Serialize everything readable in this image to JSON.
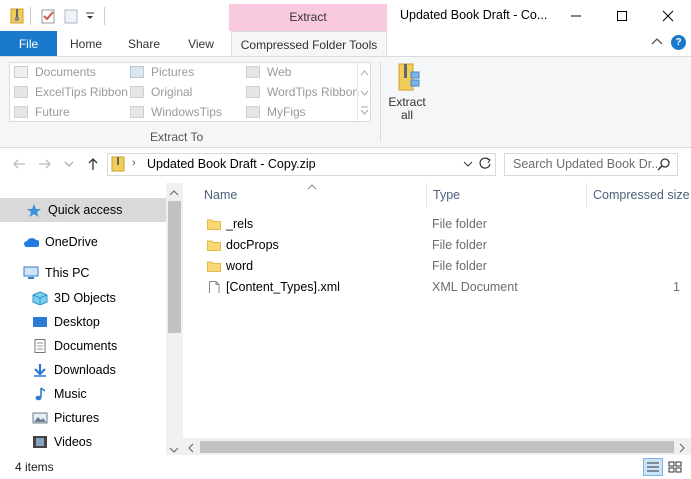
{
  "window": {
    "title": "Updated Book Draft - Co...",
    "context_tab_group": "Extract",
    "minimize_glyph": "—",
    "maximize_glyph": "☐",
    "close_glyph": "✕"
  },
  "ribbon": {
    "tabs": [
      {
        "label": "File"
      },
      {
        "label": "Home"
      },
      {
        "label": "Share"
      },
      {
        "label": "View"
      },
      {
        "label": "Compressed Folder Tools"
      }
    ],
    "active_tab": "Compressed Folder Tools",
    "extract_to": {
      "label": "Extract To",
      "destinations": [
        {
          "label": "Documents",
          "icon": "documents-icon"
        },
        {
          "label": "Pictures",
          "icon": "pictures-icon"
        },
        {
          "label": "Web",
          "icon": "folder-icon"
        },
        {
          "label": "ExcelTips Ribbon",
          "icon": "folder-icon"
        },
        {
          "label": "Original",
          "icon": "folder-icon"
        },
        {
          "label": "WordTips Ribbon",
          "icon": "folder-icon"
        },
        {
          "label": "Future",
          "icon": "folder-icon"
        },
        {
          "label": "WindowsTips",
          "icon": "folder-icon"
        },
        {
          "label": "MyFigs",
          "icon": "folder-icon"
        }
      ]
    },
    "extract_all": {
      "line1": "Extract",
      "line2": "all"
    },
    "help_glyph": "?"
  },
  "address": {
    "path": "Updated Book Draft - Copy.zip",
    "search_placeholder": "Search Updated Book Dr..."
  },
  "nav": {
    "items": [
      {
        "label": "Quick access",
        "icon": "star-icon",
        "selected": true
      },
      {
        "label": "OneDrive",
        "icon": "cloud-icon"
      },
      {
        "label": "This PC",
        "icon": "computer-icon"
      },
      {
        "label": "3D Objects",
        "icon": "cube-icon"
      },
      {
        "label": "Desktop",
        "icon": "desktop-icon"
      },
      {
        "label": "Documents",
        "icon": "document-icon"
      },
      {
        "label": "Downloads",
        "icon": "download-icon"
      },
      {
        "label": "Music",
        "icon": "music-icon"
      },
      {
        "label": "Pictures",
        "icon": "pictures-icon"
      },
      {
        "label": "Videos",
        "icon": "video-icon"
      }
    ]
  },
  "content": {
    "columns": {
      "name": "Name",
      "type": "Type",
      "compressed_size": "Compressed size"
    },
    "rows": [
      {
        "name": "_rels",
        "type": "File folder",
        "size": "",
        "icon": "folder-icon"
      },
      {
        "name": "docProps",
        "type": "File folder",
        "size": "",
        "icon": "folder-icon"
      },
      {
        "name": "word",
        "type": "File folder",
        "size": "",
        "icon": "folder-icon"
      },
      {
        "name": "[Content_Types].xml",
        "type": "XML Document",
        "size": "1",
        "icon": "file-icon"
      }
    ]
  },
  "status": {
    "item_count": "4 items"
  },
  "colors": {
    "accent": "#1979ca",
    "context_tab": "#f9c9e0",
    "folder": "#f8d775"
  }
}
